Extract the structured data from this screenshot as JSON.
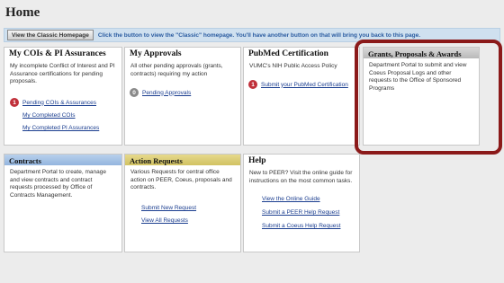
{
  "page": {
    "title": "Home"
  },
  "classic": {
    "button_label": "View the Classic Homepage",
    "message": "Click the button to view the \"Classic\" homepage. You'll have another button on that will bring you back to this page."
  },
  "cards": {
    "cois": {
      "title": "My COIs & PI Assurances",
      "desc": "My incomplete Conflict of Interest and PI Assurance certifications for pending proposals.",
      "badge": "1",
      "link_pending": "Pending COIs & Assurances",
      "link_completed_cois": "My Completed COIs",
      "link_completed_pi": "My Completed PI Assurances"
    },
    "approvals": {
      "title": "My Approvals",
      "desc": "All other pending approvals (grants, contracts) requiring my action",
      "badge": "0",
      "link": "Pending Approvals"
    },
    "pubmed": {
      "title": "PubMed Certification",
      "desc": "VUMC's NIH Public Access Policy",
      "badge": "1",
      "link": "Submit your PubMed Certification"
    },
    "grants": {
      "title": "Grants, Proposals & Awards",
      "desc": "Department Portal to submit and view Coeus Proposal Logs and other requests to the Office of Sponsored Programs"
    },
    "contracts": {
      "title": "Contracts",
      "desc": "Department Portal to create, manage and view contracts and contract requests processed by Office of Contracts Management."
    },
    "actions": {
      "title": "Action Requests",
      "desc": "Various Requests for central office action on PEER, Coeus, proposals and contracts.",
      "link_new": "Submit New Request",
      "link_all": "View All Requests"
    },
    "help": {
      "title": "Help",
      "desc": "New to PEER? Visit the online guide for instructions on the most common tasks.",
      "link_guide": "View the Online Guide",
      "link_peer": "Submit a PEER Help Request",
      "link_coeus": "Submit a Coeus Help Request"
    }
  },
  "colors": {
    "highlight": "#8b1a1a",
    "link": "#1a3d8f",
    "badge_red": "#c0303a"
  }
}
